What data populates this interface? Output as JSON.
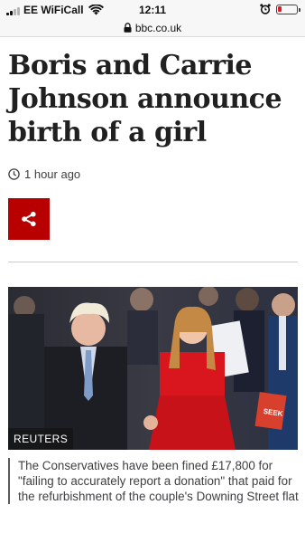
{
  "status_bar": {
    "carrier": "EE WiFiCall",
    "time": "12:11",
    "icons": [
      "signal-icon",
      "wifi-icon",
      "alarm-icon",
      "battery-icon"
    ],
    "battery_color": "#e21b2c"
  },
  "browser": {
    "url": "bbc.co.uk",
    "icons": [
      "lock-icon"
    ]
  },
  "article": {
    "headline": "Boris and Carrie Johnson announce birth of a girl",
    "timestamp": "1 hour ago",
    "icons": [
      "clock-icon",
      "share-icon"
    ],
    "share_color": "#b80000",
    "image": {
      "credit": "REUTERS",
      "placard_text": "SEEK"
    },
    "caption": "The Conservatives have been fined £17,800 for \"failing to accurately report a donation\" that paid for the refurbishment of the couple's Downing Street flat"
  }
}
